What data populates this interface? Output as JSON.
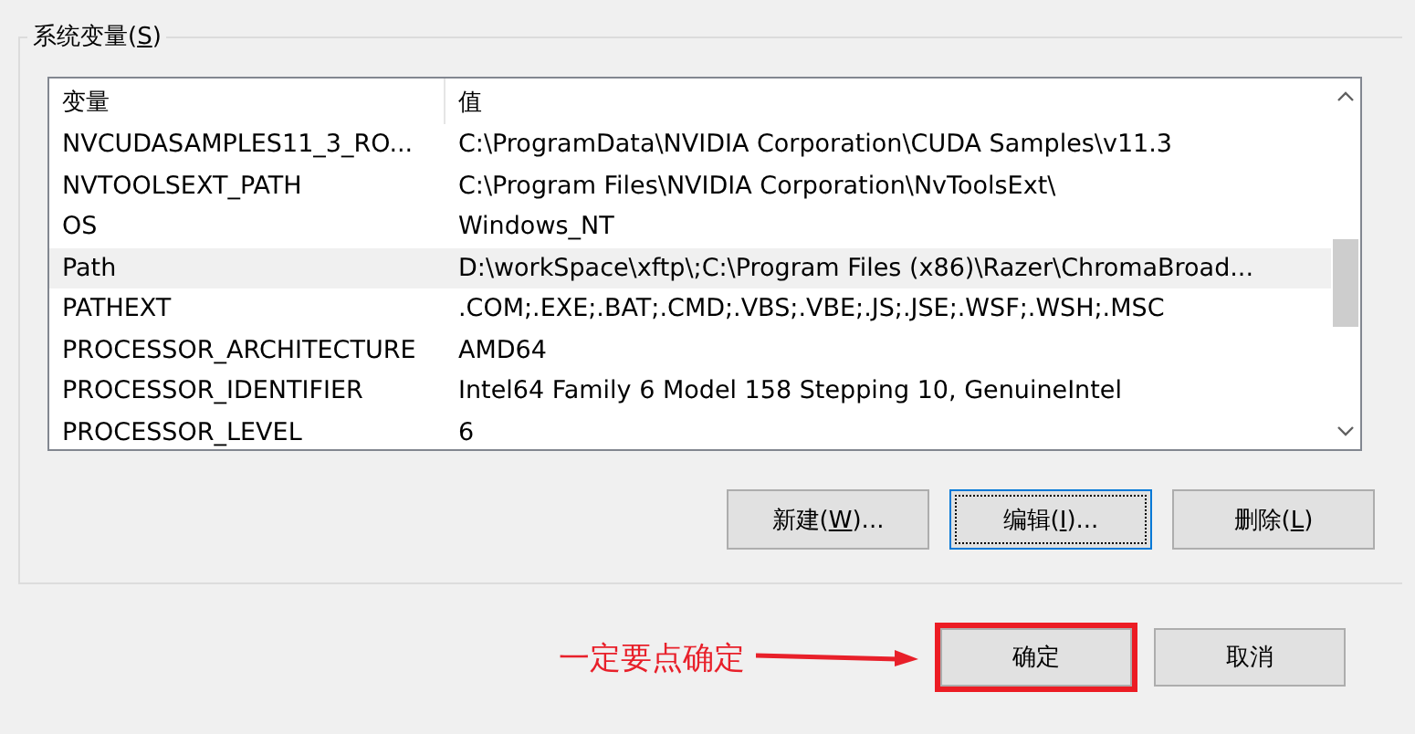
{
  "group": {
    "prefix": "系统变量(",
    "key": "S",
    "suffix": ")"
  },
  "table": {
    "columns": [
      "变量",
      "值"
    ],
    "rows": [
      {
        "name": "NVCUDASAMPLES11_3_RO...",
        "value": "C:\\ProgramData\\NVIDIA Corporation\\CUDA Samples\\v11.3",
        "selected": false
      },
      {
        "name": "NVTOOLSEXT_PATH",
        "value": "C:\\Program Files\\NVIDIA Corporation\\NvToolsExt\\",
        "selected": false
      },
      {
        "name": "OS",
        "value": "Windows_NT",
        "selected": false
      },
      {
        "name": "Path",
        "value": "D:\\workSpace\\xftp\\;C:\\Program Files (x86)\\Razer\\ChromaBroad...",
        "selected": true
      },
      {
        "name": "PATHEXT",
        "value": ".COM;.EXE;.BAT;.CMD;.VBS;.VBE;.JS;.JSE;.WSF;.WSH;.MSC",
        "selected": false
      },
      {
        "name": "PROCESSOR_ARCHITECTURE",
        "value": "AMD64",
        "selected": false
      },
      {
        "name": "PROCESSOR_IDENTIFIER",
        "value": "Intel64 Family 6 Model 158 Stepping 10, GenuineIntel",
        "selected": false
      },
      {
        "name": "PROCESSOR_LEVEL",
        "value": "6",
        "selected": false
      }
    ]
  },
  "list_buttons": [
    {
      "prefix": "新建(",
      "key": "W",
      "suffix": ")...",
      "focused": false
    },
    {
      "prefix": "编辑(",
      "key": "I",
      "suffix": ")...",
      "focused": true
    },
    {
      "prefix": "删除(",
      "key": "L",
      "suffix": ")",
      "focused": false
    }
  ],
  "annotation": {
    "text": "一定要点确定"
  },
  "dialog_buttons": [
    {
      "label": "确定",
      "highlighted": true
    },
    {
      "label": "取消",
      "highlighted": false
    }
  ]
}
